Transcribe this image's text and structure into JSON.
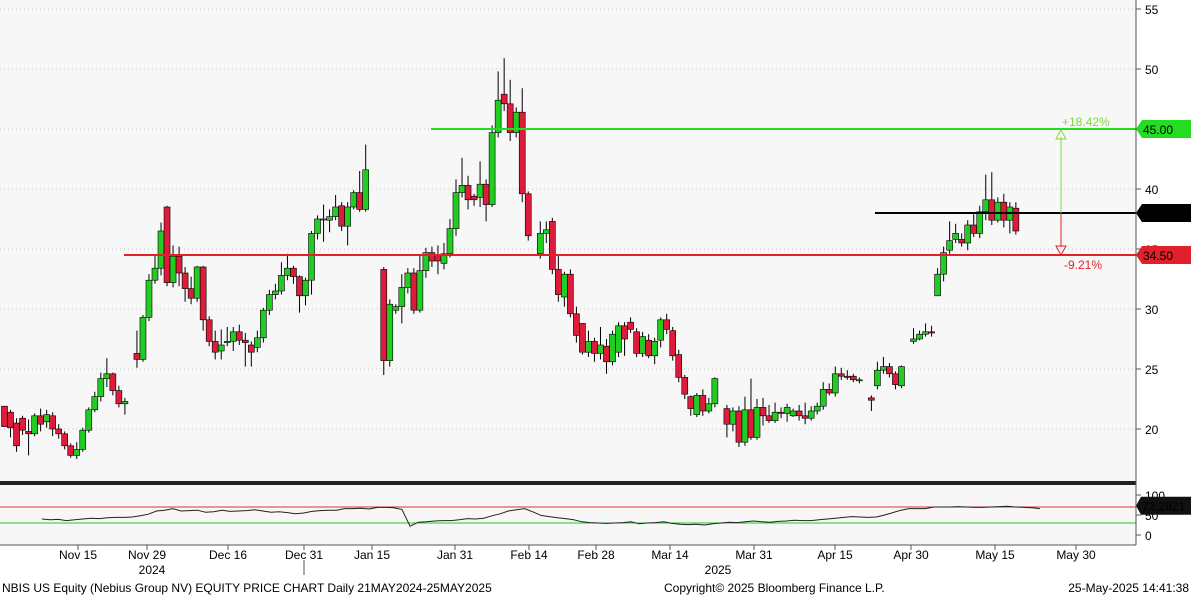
{
  "chart_data": [
    {
      "type": "candlestick",
      "title": "NBIS US Equity (Nebius Group NV) EQUITY PRICE CHART",
      "ylim": [
        15,
        56
      ],
      "y_ticks": [
        "55",
        "50",
        "45",
        "40",
        "35",
        "30",
        "25",
        "20"
      ],
      "x_ticks": [
        "Nov 15",
        "Nov 29",
        "Dec 16",
        "Dec 31",
        "Jan 15",
        "Jan 31",
        "Feb 14",
        "Feb 28",
        "Mar 14",
        "Mar 31",
        "Apr 15",
        "Apr 30",
        "May 15",
        "May 30"
      ],
      "x_year_labels": [
        {
          "label": "2024",
          "at": "Nov 29"
        },
        {
          "label": "2025",
          "at": "Mar 31"
        }
      ],
      "ohlc": [
        [
          21.9,
          20.2,
          21.7,
          21.2
        ],
        [
          21.4,
          20.1,
          21.6,
          19.3
        ],
        [
          20.5,
          18.6,
          20.9,
          18.1
        ],
        [
          20.9,
          19.9,
          21.1,
          19.5
        ],
        [
          19.8,
          19.6,
          20.8,
          17.8
        ],
        [
          19.6,
          21.1,
          21.3,
          19.4
        ],
        [
          21.1,
          20.4,
          21.7,
          19.8
        ],
        [
          20.6,
          21.2,
          21.6,
          20.1
        ],
        [
          21.1,
          20.0,
          21.4,
          19.4
        ],
        [
          20.0,
          19.6,
          20.4,
          19.2
        ],
        [
          19.6,
          18.6,
          19.8,
          18.3
        ],
        [
          18.6,
          17.8,
          18.8,
          17.6
        ],
        [
          17.8,
          18.3,
          18.9,
          17.5
        ],
        [
          18.3,
          19.9,
          20.1,
          18.1
        ],
        [
          19.9,
          21.6,
          21.8,
          19.7
        ],
        [
          21.6,
          22.7,
          23.1,
          21.4
        ],
        [
          22.7,
          24.2,
          24.7,
          22.3
        ],
        [
          24.2,
          24.6,
          25.9,
          23.5
        ],
        [
          24.6,
          23.2,
          24.7,
          22.8
        ],
        [
          23.2,
          22.1,
          23.6,
          21.8
        ],
        [
          22.1,
          22.3,
          22.6,
          21.2
        ],
        [
          null,
          null,
          null,
          null
        ],
        [
          26.3,
          25.8,
          28.2,
          25.1
        ],
        [
          25.8,
          29.3,
          29.5,
          25.6
        ],
        [
          29.3,
          32.4,
          32.9,
          29.0
        ],
        [
          32.4,
          33.4,
          34.5,
          32.1
        ],
        [
          33.4,
          36.5,
          37.2,
          32.8
        ],
        [
          38.5,
          32.2,
          38.6,
          31.9
        ],
        [
          32.2,
          34.4,
          35.3,
          31.8
        ],
        [
          34.4,
          33.0,
          35.2,
          31.9
        ],
        [
          33.0,
          31.7,
          33.5,
          30.6
        ],
        [
          31.7,
          30.9,
          32.7,
          30.4
        ],
        [
          30.9,
          33.5,
          33.6,
          30.6
        ],
        [
          33.5,
          29.1,
          33.6,
          28.2
        ],
        [
          29.1,
          27.3,
          29.4,
          26.9
        ],
        [
          27.3,
          26.4,
          28.2,
          25.8
        ],
        [
          26.5,
          27.0,
          28.3,
          25.8
        ],
        [
          27.2,
          27.3,
          28.5,
          26.9
        ],
        [
          27.3,
          28.1,
          28.5,
          26.5
        ],
        [
          28.1,
          27.4,
          28.7,
          27.0
        ],
        [
          27.4,
          27.2,
          28.0,
          25.2
        ],
        [
          27.0,
          26.4,
          27.3,
          25.2
        ],
        [
          26.8,
          27.6,
          28.2,
          26.4
        ],
        [
          27.6,
          29.9,
          30.1,
          27.2
        ],
        [
          29.9,
          31.2,
          31.6,
          29.5
        ],
        [
          31.2,
          31.5,
          32.1,
          30.8
        ],
        [
          31.5,
          32.8,
          33.9,
          31.2
        ],
        [
          32.8,
          33.4,
          34.6,
          32.4
        ],
        [
          33.4,
          32.7,
          33.6,
          32.1
        ],
        [
          32.7,
          31.1,
          32.8,
          29.7
        ],
        [
          31.1,
          32.4,
          32.6,
          30.3
        ],
        [
          32.4,
          36.3,
          36.5,
          31.2
        ],
        [
          36.3,
          37.5,
          37.8,
          35.8
        ],
        [
          37.5,
          37.5,
          38.7,
          35.6
        ],
        [
          37.4,
          37.7,
          38.3,
          36.4
        ],
        [
          37.7,
          38.5,
          39.5,
          37.4
        ],
        [
          38.6,
          36.9,
          38.9,
          36.5
        ],
        [
          36.9,
          38.5,
          38.9,
          35.3
        ],
        [
          38.5,
          39.7,
          39.9,
          38.3
        ],
        [
          39.7,
          38.3,
          41.5,
          38.1
        ],
        [
          38.3,
          41.6,
          43.7,
          38.1
        ],
        [
          null,
          null,
          null,
          null
        ],
        [
          null,
          null,
          null,
          null
        ],
        [
          33.3,
          25.7,
          33.5,
          24.5
        ],
        [
          25.7,
          30.4,
          30.8,
          25.2
        ],
        [
          29.9,
          30.2,
          30.4,
          29.6
        ],
        [
          30.2,
          31.8,
          32.9,
          28.8
        ],
        [
          31.8,
          33.0,
          33.4,
          31.3
        ],
        [
          33.0,
          29.9,
          33.4,
          29.6
        ],
        [
          29.9,
          33.2,
          34.5,
          29.7
        ],
        [
          33.2,
          34.7,
          35.1,
          32.6
        ],
        [
          34.7,
          34.0,
          35.2,
          33.5
        ],
        [
          34.5,
          34.0,
          35.3,
          32.9
        ],
        [
          33.8,
          34.6,
          35.5,
          33.3
        ],
        [
          34.6,
          36.7,
          37.5,
          34.3
        ],
        [
          36.7,
          39.7,
          40.8,
          36.1
        ],
        [
          39.7,
          40.3,
          42.6,
          39.3
        ],
        [
          40.3,
          39.1,
          41.1,
          38.3
        ],
        [
          39.4,
          39.1,
          39.6,
          38.6
        ],
        [
          39.3,
          40.4,
          42.3,
          38.5
        ],
        [
          40.4,
          38.7,
          40.8,
          37.3
        ],
        [
          38.7,
          44.7,
          45.3,
          38.5
        ],
        [
          44.7,
          47.4,
          49.8,
          44.3
        ],
        [
          47.9,
          47.1,
          50.9,
          46.5
        ],
        [
          47.1,
          44.7,
          49.1,
          44.0
        ],
        [
          44.7,
          46.4,
          46.8,
          44.3
        ],
        [
          46.4,
          39.6,
          48.4,
          38.9
        ],
        [
          39.6,
          36.1,
          39.8,
          35.7
        ],
        [
          null,
          null,
          null,
          null
        ],
        [
          34.6,
          36.3,
          37.3,
          34.2
        ],
        [
          36.3,
          36.6,
          37.3,
          35.5
        ],
        [
          37.3,
          33.3,
          37.6,
          32.9
        ],
        [
          33.3,
          31.2,
          34.5,
          30.6
        ],
        [
          31.0,
          32.9,
          33.1,
          30.2
        ],
        [
          32.9,
          29.6,
          33.3,
          29.3
        ],
        [
          29.6,
          27.8,
          30.2,
          27.2
        ],
        [
          28.8,
          26.4,
          28.8,
          26.2
        ],
        [
          26.4,
          27.3,
          28.2,
          26.0
        ],
        [
          27.3,
          26.3,
          27.6,
          25.6
        ],
        [
          26.3,
          27.0,
          28.5,
          25.8
        ],
        [
          26.9,
          25.6,
          27.5,
          24.6
        ],
        [
          25.6,
          27.9,
          28.2,
          25.3
        ],
        [
          26.4,
          28.6,
          28.9,
          26.0
        ],
        [
          28.6,
          27.5,
          28.9,
          26.1
        ],
        [
          28.9,
          28.3,
          29.3,
          28.0
        ],
        [
          28.1,
          26.3,
          28.4,
          26.0
        ],
        [
          26.3,
          27.7,
          28.1,
          26.0
        ],
        [
          27.4,
          26.1,
          27.9,
          25.9
        ],
        [
          26.1,
          27.3,
          27.6,
          25.4
        ],
        [
          27.4,
          29.1,
          29.3,
          26.8
        ],
        [
          29.1,
          28.3,
          29.6,
          27.9
        ],
        [
          28.2,
          26.1,
          28.5,
          25.7
        ],
        [
          26.2,
          24.3,
          26.6,
          23.9
        ],
        [
          24.3,
          22.9,
          24.5,
          22.5
        ],
        [
          22.7,
          21.7,
          22.8,
          21.1
        ],
        [
          21.2,
          22.8,
          23.0,
          21.0
        ],
        [
          22.8,
          21.5,
          23.3,
          21.1
        ],
        [
          21.5,
          22.1,
          22.6,
          21.3
        ],
        [
          22.1,
          24.2,
          24.3,
          21.8
        ],
        [
          null,
          null,
          null,
          null
        ],
        [
          21.7,
          20.4,
          22.0,
          19.3
        ],
        [
          20.4,
          21.5,
          21.8,
          19.8
        ],
        [
          21.5,
          18.9,
          21.9,
          18.5
        ],
        [
          18.9,
          21.6,
          22.7,
          18.6
        ],
        [
          21.6,
          19.3,
          24.2,
          19.1
        ],
        [
          19.3,
          21.8,
          22.5,
          19.1
        ],
        [
          21.8,
          21.1,
          22.6,
          20.3
        ],
        [
          21.1,
          20.7,
          22.0,
          20.5
        ],
        [
          20.7,
          21.4,
          22.2,
          20.5
        ],
        [
          21.4,
          21.3,
          21.8,
          20.9
        ],
        [
          21.3,
          21.8,
          22.1,
          20.6
        ],
        [
          21.1,
          21.5,
          21.7,
          21.0
        ],
        [
          21.5,
          21.1,
          22.0,
          20.7
        ],
        [
          21.1,
          20.9,
          22.2,
          20.4
        ],
        [
          20.9,
          21.5,
          21.9,
          20.7
        ],
        [
          21.5,
          21.9,
          22.2,
          21.2
        ],
        [
          21.9,
          23.3,
          23.9,
          21.6
        ],
        [
          23.3,
          23.0,
          23.8,
          22.8
        ],
        [
          23.0,
          24.6,
          25.2,
          22.7
        ],
        [
          24.6,
          24.4,
          25.1,
          24.1
        ],
        [
          24.4,
          24.3,
          24.9,
          24.1
        ],
        [
          24.4,
          24.1,
          24.6,
          23.9
        ],
        [
          24.1,
          24.1,
          24.3,
          23.8
        ],
        [
          null,
          null,
          null,
          null
        ],
        [
          22.6,
          22.4,
          22.8,
          21.5
        ],
        [
          23.6,
          24.9,
          25.6,
          23.3
        ],
        [
          24.9,
          25.2,
          26.0,
          24.6
        ],
        [
          25.2,
          24.6,
          25.5,
          24.3
        ],
        [
          24.6,
          23.7,
          24.8,
          23.3
        ],
        [
          23.6,
          25.2,
          25.3,
          23.4
        ],
        [
          null,
          null,
          null,
          null
        ],
        [
          27.3,
          27.5,
          28.4,
          27.1
        ],
        [
          27.5,
          27.9,
          28.2,
          27.4
        ],
        [
          27.9,
          28.1,
          28.8,
          27.7
        ],
        [
          28.1,
          28.0,
          28.6,
          27.7
        ],
        [
          31.1,
          32.9,
          33.4,
          31.2
        ],
        [
          32.9,
          34.7,
          35.2,
          32.3
        ],
        [
          34.9,
          35.7,
          37.3,
          34.6
        ],
        [
          35.8,
          36.3,
          37.1,
          35.5
        ],
        [
          35.8,
          35.5,
          36.3,
          35.2
        ],
        [
          35.5,
          37.0,
          37.4,
          34.9
        ],
        [
          37.0,
          36.3,
          37.9,
          36.0
        ],
        [
          36.3,
          38.1,
          38.6,
          35.9
        ],
        [
          38.1,
          39.1,
          41.2,
          37.4
        ],
        [
          39.1,
          37.4,
          41.4,
          37.0
        ],
        [
          37.4,
          38.9,
          39.3,
          37.2
        ],
        [
          38.9,
          37.4,
          39.6,
          36.8
        ],
        [
          37.4,
          38.5,
          38.9,
          36.3
        ],
        [
          38.4,
          36.5,
          38.9,
          36.2
        ]
      ],
      "horizontal_lines": [
        {
          "label": "45.00",
          "value": 45.0,
          "color": "#22dd22"
        },
        {
          "label": "38.00",
          "value": 38.0,
          "color": "#000000"
        },
        {
          "label": "34.50",
          "value": 34.5,
          "color": "#e0202a"
        }
      ],
      "annotations": [
        {
          "text": "+18.42%",
          "value": 45.0,
          "color": "#7ddb3e"
        },
        {
          "text": "-9.21%",
          "value": 34.5,
          "color": "#e0202a"
        }
      ],
      "colors": {
        "up": "#22cc22",
        "down": "#dd1c3b",
        "wick": "#000000"
      }
    },
    {
      "type": "line",
      "title": "RSI",
      "last_value_label": "73.2821",
      "y_ticks": [
        "100",
        "50",
        "0"
      ],
      "ylim": [
        0,
        100
      ],
      "reference_lines": [
        70,
        30
      ],
      "values": [
        40,
        38,
        39,
        36,
        38,
        40,
        42,
        41,
        43,
        44,
        44,
        45,
        48,
        52,
        60,
        62,
        66,
        60,
        61,
        62,
        57,
        58,
        62,
        59,
        60,
        61,
        63,
        60,
        57,
        58,
        56,
        53,
        55,
        59,
        61,
        62,
        62,
        66,
        66,
        67,
        65,
        69,
        69,
        68,
        64,
        22,
        32,
        33,
        35,
        36,
        36,
        38,
        41,
        40,
        42,
        48,
        53,
        60,
        63,
        66,
        58,
        49,
        46,
        43,
        41,
        38,
        33,
        31,
        30,
        29,
        30,
        31,
        33,
        28,
        30,
        31,
        33,
        29,
        27,
        26,
        27,
        25,
        28,
        30,
        32,
        31,
        33,
        35,
        33,
        32,
        34,
        35,
        37,
        36,
        36,
        38,
        40,
        42,
        44,
        46,
        45,
        44,
        45,
        50,
        56,
        62,
        66,
        66,
        66,
        70,
        70,
        70,
        71,
        70,
        69,
        69,
        70,
        71,
        72,
        70,
        69,
        68,
        66
      ]
    }
  ],
  "footer": {
    "left": "NBIS US Equity (Nebius Group NV) EQUITY PRICE CHART  Daily 21MAY2024-25MAY2025",
    "center": "Copyright© 2025 Bloomberg Finance L.P.",
    "right": "25-May-2025 14:41:38"
  }
}
